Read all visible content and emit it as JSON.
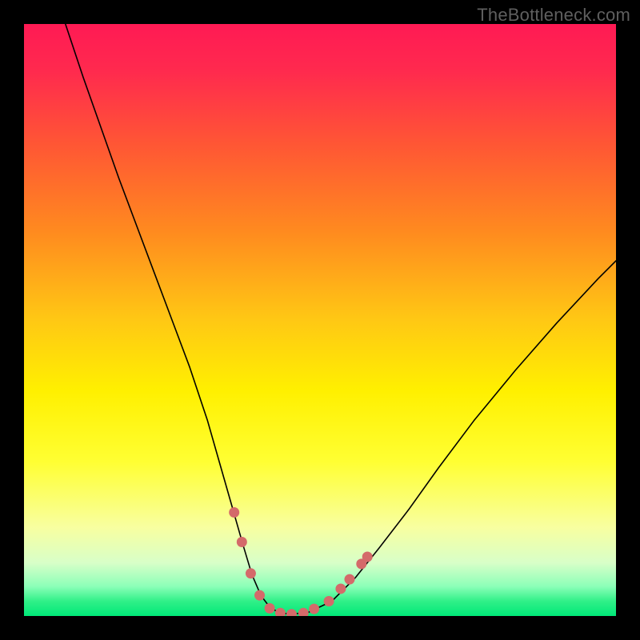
{
  "watermark": "TheBottleneck.com",
  "chart_data": {
    "type": "line",
    "title": "",
    "xlabel": "",
    "ylabel": "",
    "xlim": [
      0,
      100
    ],
    "ylim": [
      0,
      100
    ],
    "background_gradient": {
      "stops": [
        {
          "offset": 0.0,
          "color": "#ff1a54"
        },
        {
          "offset": 0.08,
          "color": "#ff2a4e"
        },
        {
          "offset": 0.2,
          "color": "#ff5535"
        },
        {
          "offset": 0.35,
          "color": "#ff8a1f"
        },
        {
          "offset": 0.5,
          "color": "#ffc814"
        },
        {
          "offset": 0.62,
          "color": "#fff000"
        },
        {
          "offset": 0.74,
          "color": "#ffff33"
        },
        {
          "offset": 0.85,
          "color": "#f8ffa0"
        },
        {
          "offset": 0.91,
          "color": "#d8ffc8"
        },
        {
          "offset": 0.95,
          "color": "#8cffb8"
        },
        {
          "offset": 0.975,
          "color": "#30f088"
        },
        {
          "offset": 1.0,
          "color": "#00e878"
        }
      ]
    },
    "series": [
      {
        "name": "bottleneck-curve",
        "color": "#000000",
        "stroke_width": 1.6,
        "x": [
          7,
          10,
          13,
          16,
          19,
          22,
          25,
          28,
          31,
          33,
          35,
          37,
          38.5,
          40,
          41.5,
          43,
          45,
          48,
          52,
          56,
          60,
          65,
          70,
          76,
          83,
          90,
          97,
          100
        ],
        "y": [
          100,
          91,
          82.5,
          74,
          66,
          58,
          50,
          42,
          33,
          26,
          19,
          12,
          7,
          3.5,
          1.5,
          0.6,
          0.3,
          0.6,
          2.5,
          6.5,
          11.5,
          18,
          25,
          33,
          41.5,
          49.5,
          57,
          60
        ]
      }
    ],
    "highlight": {
      "name": "bottom-dots",
      "color": "#d46a6a",
      "radius": 6.5,
      "points": [
        {
          "x": 35.5,
          "y": 17.5
        },
        {
          "x": 36.8,
          "y": 12.5
        },
        {
          "x": 38.3,
          "y": 7.2
        },
        {
          "x": 39.8,
          "y": 3.5
        },
        {
          "x": 41.5,
          "y": 1.3
        },
        {
          "x": 43.3,
          "y": 0.5
        },
        {
          "x": 45.2,
          "y": 0.3
        },
        {
          "x": 47.2,
          "y": 0.5
        },
        {
          "x": 49.0,
          "y": 1.2
        },
        {
          "x": 51.5,
          "y": 2.5
        },
        {
          "x": 53.5,
          "y": 4.6
        },
        {
          "x": 55.0,
          "y": 6.2
        },
        {
          "x": 57.0,
          "y": 8.8
        },
        {
          "x": 58.0,
          "y": 10.0
        }
      ]
    }
  }
}
